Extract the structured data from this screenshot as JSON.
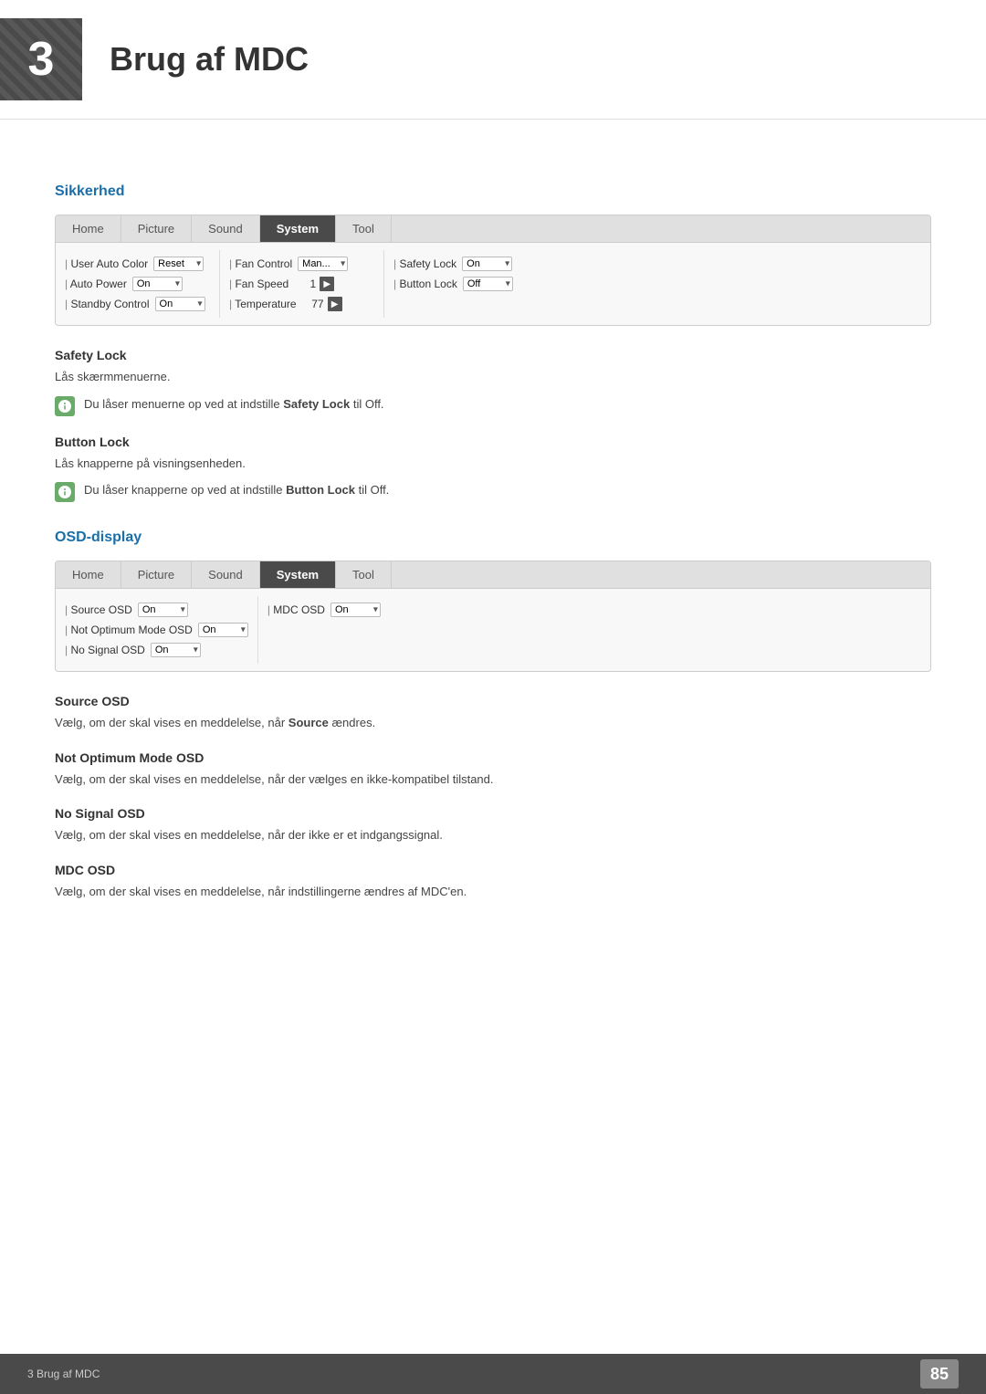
{
  "header": {
    "chapter_num": "3",
    "chapter_title": "Brug af MDC"
  },
  "sections": {
    "sikkerhed": {
      "heading": "Sikkerhed",
      "panel1": {
        "tabs": [
          "Home",
          "Picture",
          "Sound",
          "System",
          "Tool"
        ],
        "active_tab": "System",
        "columns": [
          {
            "rows": [
              {
                "label": "User Auto Color",
                "control_type": "select",
                "value": "Reset"
              },
              {
                "label": "Auto Power",
                "control_type": "select",
                "value": "On"
              },
              {
                "label": "Standby Control",
                "control_type": "select",
                "value": "On"
              }
            ]
          },
          {
            "rows": [
              {
                "label": "Fan Control",
                "control_type": "select",
                "value": "Man..."
              },
              {
                "label": "Fan Speed",
                "control_type": "arrow",
                "value": "1"
              },
              {
                "label": "Temperature",
                "control_type": "arrow",
                "value": "77"
              }
            ]
          },
          {
            "rows": [
              {
                "label": "Safety Lock",
                "control_type": "select",
                "value": "On"
              },
              {
                "label": "Button Lock",
                "control_type": "select",
                "value": "Off"
              }
            ]
          }
        ]
      },
      "safety_lock": {
        "sub_heading": "Safety Lock",
        "text": "Lås skærmmenuerne.",
        "note": "Du låser menuerne op ved at indstille Safety Lock til Off.",
        "note_bold": "Safety Lock",
        "note_suffix": " til Off."
      },
      "button_lock": {
        "sub_heading": "Button Lock",
        "text": "Lås knapperne på visningsenheden.",
        "note": "Du låser knapperne op ved at indstille Button Lock til Off.",
        "note_bold": "Button Lock",
        "note_suffix": " til Off."
      }
    },
    "osd_display": {
      "heading": "OSD-display",
      "panel2": {
        "tabs": [
          "Home",
          "Picture",
          "Sound",
          "System",
          "Tool"
        ],
        "active_tab": "System",
        "columns": [
          {
            "rows": [
              {
                "label": "Source OSD",
                "control_type": "select",
                "value": "On"
              },
              {
                "label": "Not Optimum Mode OSD",
                "control_type": "select",
                "value": "On"
              },
              {
                "label": "No Signal OSD",
                "control_type": "select",
                "value": "On"
              }
            ]
          },
          {
            "rows": [
              {
                "label": "MDC OSD",
                "control_type": "select",
                "value": "On"
              }
            ]
          }
        ]
      },
      "source_osd": {
        "sub_heading": "Source OSD",
        "text": "Vælg, om der skal vises en meddelelse, når Source ændres."
      },
      "not_optimum": {
        "sub_heading": "Not Optimum Mode OSD",
        "text": "Vælg, om der skal vises en meddelelse, når der vælges en ikke-kompatibel tilstand."
      },
      "no_signal": {
        "sub_heading": "No Signal OSD",
        "text": "Vælg, om der skal vises en meddelelse, når der ikke er et indgangssignal."
      },
      "mdc_osd": {
        "sub_heading": "MDC OSD",
        "text": "Vælg, om der skal vises en meddelelse, når indstillingerne ændres af MDC'en."
      }
    }
  },
  "footer": {
    "left_text": "3 Brug af MDC",
    "page_num": "85"
  },
  "ui": {
    "bold_safety": "Safety Lock",
    "bold_button": "Button Lock",
    "bold_source": "Source",
    "note1_pre": "Du låser menuerne op ved at indstille ",
    "note1_post": " til Off.",
    "note2_pre": "Du låser knapperne op ved at indstille ",
    "note2_post": " til Off."
  }
}
